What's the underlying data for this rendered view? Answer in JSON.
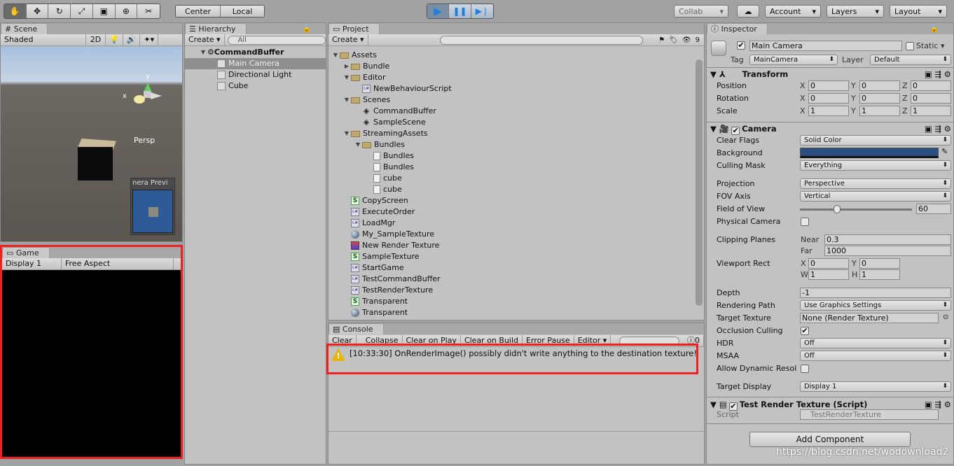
{
  "toolbar": {
    "tools": [
      "hand-tool",
      "move-tool",
      "rotate-tool",
      "scale-tool",
      "rect-tool",
      "transform-tool",
      "custom-tool"
    ],
    "pivot": "Center",
    "space": "Local",
    "collab": "Collab",
    "account": "Account",
    "layers": "Layers",
    "layout": "Layout"
  },
  "scene": {
    "tab": "Scene",
    "shading": "Shaded",
    "mode_2d": "2D",
    "gizmo_label": "Persp",
    "axis_y": "y",
    "axis_x": "x",
    "preview_title": "nera Previ"
  },
  "game": {
    "tab": "Game",
    "display": "Display 1",
    "aspect": "Free Aspect"
  },
  "hierarchy": {
    "tab": "Hierarchy",
    "create": "Create",
    "search_placeholder": "All",
    "scene_name": "CommandBuffer",
    "items": [
      "Main Camera",
      "Directional Light",
      "Cube"
    ]
  },
  "project": {
    "tab": "Project",
    "create": "Create",
    "count": "9",
    "items": [
      {
        "label": "Assets",
        "depth": 0,
        "icon": "folder-open"
      },
      {
        "label": "Bundle",
        "depth": 1,
        "icon": "folder"
      },
      {
        "label": "Editor",
        "depth": 1,
        "icon": "folder-open"
      },
      {
        "label": "NewBehaviourScript",
        "depth": 2,
        "icon": "cs-script"
      },
      {
        "label": "Scenes",
        "depth": 1,
        "icon": "folder-open"
      },
      {
        "label": "CommandBuffer",
        "depth": 2,
        "icon": "unity-scene"
      },
      {
        "label": "SampleScene",
        "depth": 2,
        "icon": "unity-scene"
      },
      {
        "label": "StreamingAssets",
        "depth": 1,
        "icon": "folder-open"
      },
      {
        "label": "Bundles",
        "depth": 2,
        "icon": "folder-open"
      },
      {
        "label": "Bundles",
        "depth": 3,
        "icon": "file"
      },
      {
        "label": "Bundles",
        "depth": 3,
        "icon": "file"
      },
      {
        "label": "cube",
        "depth": 3,
        "icon": "file"
      },
      {
        "label": "cube",
        "depth": 3,
        "icon": "file"
      },
      {
        "label": "CopyScreen",
        "depth": 1,
        "icon": "shader"
      },
      {
        "label": "ExecuteOrder",
        "depth": 1,
        "icon": "cs-script"
      },
      {
        "label": "LoadMgr",
        "depth": 1,
        "icon": "cs-script"
      },
      {
        "label": "My_SampleTexture",
        "depth": 1,
        "icon": "material"
      },
      {
        "label": "New Render Texture",
        "depth": 1,
        "icon": "render-texture"
      },
      {
        "label": "SampleTexture",
        "depth": 1,
        "icon": "shader"
      },
      {
        "label": "StartGame",
        "depth": 1,
        "icon": "cs-script"
      },
      {
        "label": "TestCommandBuffer",
        "depth": 1,
        "icon": "cs-script"
      },
      {
        "label": "TestRenderTexture",
        "depth": 1,
        "icon": "cs-script"
      },
      {
        "label": "Transparent",
        "depth": 1,
        "icon": "shader"
      },
      {
        "label": "Transparent",
        "depth": 1,
        "icon": "material"
      }
    ]
  },
  "console": {
    "tab": "Console",
    "buttons": [
      "Clear",
      "Collapse",
      "Clear on Play",
      "Clear on Build",
      "Error Pause",
      "Editor"
    ],
    "error_count": "0",
    "message": "[10:33:30] OnRenderImage() possibly didn't write anything to the destination texture!"
  },
  "inspector": {
    "tab": "Inspector",
    "name": "Main Camera",
    "static": "Static",
    "tag_label": "Tag",
    "tag": "MainCamera",
    "layer_label": "Layer",
    "layer": "Default",
    "transform": {
      "title": "Transform",
      "position": "Position",
      "rotation": "Rotation",
      "scale": "Scale",
      "pos": [
        "0",
        "0",
        "0"
      ],
      "rot": [
        "0",
        "0",
        "0"
      ],
      "scl": [
        "1",
        "1",
        "1"
      ]
    },
    "camera": {
      "title": "Camera",
      "clear_flags_label": "Clear Flags",
      "clear_flags": "Solid Color",
      "background_label": "Background",
      "background_color": "#2b4f82",
      "culling_mask_label": "Culling Mask",
      "culling_mask": "Everything",
      "projection_label": "Projection",
      "projection": "Perspective",
      "fov_axis_label": "FOV Axis",
      "fov_axis": "Vertical",
      "fov_label": "Field of View",
      "fov": "60",
      "physical_label": "Physical Camera",
      "clipping_label": "Clipping Planes",
      "near_label": "Near",
      "near": "0.3",
      "far_label": "Far",
      "far": "1000",
      "viewport_label": "Viewport Rect",
      "vx": "0",
      "vy": "0",
      "vw": "1",
      "vh": "1",
      "depth_label": "Depth",
      "depth": "-1",
      "rendering_path_label": "Rendering Path",
      "rendering_path": "Use Graphics Settings",
      "target_texture_label": "Target Texture",
      "target_texture": "None (Render Texture)",
      "occlusion_label": "Occlusion Culling",
      "hdr_label": "HDR",
      "hdr": "Off",
      "msaa_label": "MSAA",
      "msaa": "Off",
      "dynres_label": "Allow Dynamic Resol",
      "target_display_label": "Target Display",
      "target_display": "Display 1"
    },
    "script": {
      "title": "Test Render Texture (Script)",
      "script_label": "Script",
      "script": "TestRenderTexture"
    },
    "add_component": "Add Component",
    "axes": [
      "X",
      "Y",
      "Z",
      "W",
      "H"
    ]
  },
  "watermark": "https://blog.csdn.net/wodownload2",
  "colors": {
    "highlight": "#ff2020",
    "play_accent": "#1e7fe0"
  }
}
